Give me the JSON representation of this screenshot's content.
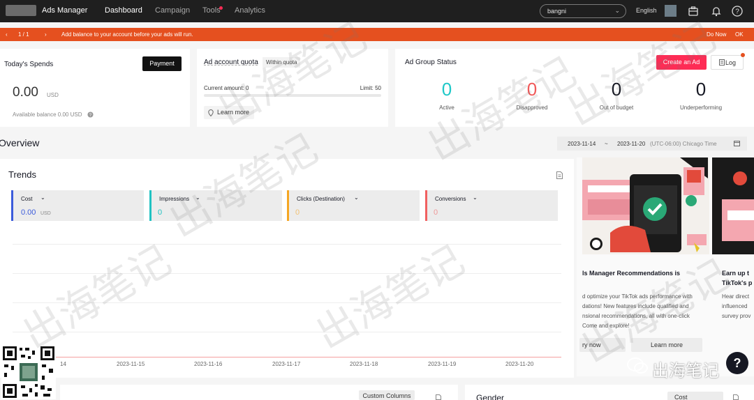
{
  "nav": {
    "brand": "Ads Manager",
    "items": [
      {
        "label": "Dashboard"
      },
      {
        "label": "Campaign"
      },
      {
        "label": "Tools"
      },
      {
        "label": "Analytics"
      }
    ],
    "account": "bangni",
    "language": "English"
  },
  "alert": {
    "page": "1 / 1",
    "message": "Add balance to your account before your ads will run.",
    "do_now": "Do Now",
    "ok": "OK"
  },
  "spends": {
    "title": "Today's Spends",
    "payment": "Payment",
    "amount": "0.00",
    "currency": "USD",
    "balance": "Available balance 0.00 USD"
  },
  "quota": {
    "title": "Ad account quota",
    "badge": "Within quota",
    "current": "Current amount: 0",
    "limit": "Limit: 50",
    "learn_more": "Learn more"
  },
  "adgroup": {
    "title": "Ad Group Status",
    "create": "Create an Ad",
    "log": "Log",
    "stats": [
      {
        "value": "0",
        "label": "Active",
        "color": "#1fc8c8"
      },
      {
        "value": "0",
        "label": "Disapproved",
        "color": "#f05a5a"
      },
      {
        "value": "0",
        "label": "Out of budget",
        "color": "#161823"
      },
      {
        "value": "0",
        "label": "Underperforming",
        "color": "#161823"
      }
    ]
  },
  "overview": {
    "title": "Overview",
    "date_start": "2023-11-14",
    "date_sep": "~",
    "date_end": "2023-11-20",
    "timezone": "(UTC-06:00) Chicago Time"
  },
  "trends": {
    "title": "Trends",
    "metrics": [
      {
        "label": "Cost",
        "value": "0.00",
        "unit": "USD",
        "color": "#3b5bdb"
      },
      {
        "label": "Impressions",
        "value": "0",
        "color": "#20c2c2"
      },
      {
        "label": "Clicks (Destination)",
        "value": "0",
        "color": "#f5a623"
      },
      {
        "label": "Conversions",
        "value": "0",
        "color": "#f06060"
      }
    ],
    "x_labels": [
      "14",
      "2023-11-15",
      "2023-11-16",
      "2023-11-17",
      "2023-11-18",
      "2023-11-19",
      "2023-11-20"
    ]
  },
  "promo": {
    "card1_title": "ls Manager Recommendations is",
    "card1_body": [
      "d optimize your TikTok ads performance with",
      "dations! New features include qualified and",
      "nsional recommendations, all with one-click",
      "Come and explore!"
    ],
    "card1_btn_a": "ry now",
    "card1_btn_b": "Learn more",
    "card2_title_1": "Earn up t",
    "card2_title_2": "TikTok's p",
    "card2_body": [
      "Hear direct",
      "influenced",
      "survey prov"
    ]
  },
  "bottom": {
    "custom_columns": "Custom Columns",
    "gender": "Gender",
    "cost": "Cost"
  },
  "watermark": {
    "text": "出海笔记",
    "corner": "出海笔记"
  }
}
